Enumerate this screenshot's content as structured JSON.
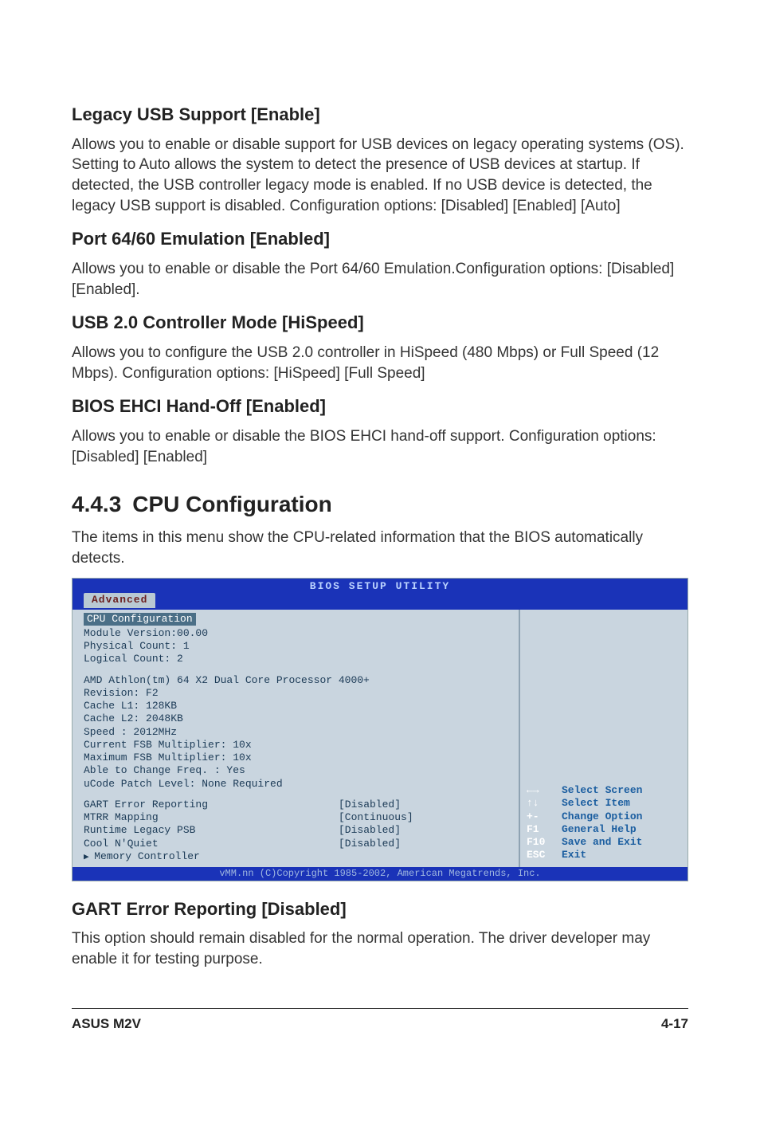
{
  "sections": {
    "legacy_usb": {
      "heading": "Legacy USB Support [Enable]",
      "text": "Allows you to enable or disable support for USB devices on legacy operating systems (OS). Setting to Auto allows the system to detect the presence of USB devices at startup. If detected, the USB controller legacy mode is enabled. If no USB device is detected, the legacy USB support is disabled. Configuration options: [Disabled] [Enabled] [Auto]"
    },
    "port6460": {
      "heading": "Port 64/60 Emulation [Enabled]",
      "text": "Allows you to enable or disable the Port 64/60 Emulation.Configuration options: [Disabled] [Enabled]."
    },
    "usb20": {
      "heading": "USB 2.0 Controller Mode [HiSpeed]",
      "text": "Allows you to configure the USB 2.0 controller in HiSpeed (480 Mbps) or Full Speed (12 Mbps). Configuration options: [HiSpeed] [Full Speed]"
    },
    "ehci": {
      "heading": "BIOS EHCI Hand-Off [Enabled]",
      "text": "Allows you to enable or disable the BIOS EHCI hand-off support. Configuration options: [Disabled] [Enabled]"
    }
  },
  "cpu_section": {
    "num": "4.4.3",
    "title": "CPU Configuration",
    "intro": "The items in this menu show the CPU-related information that the BIOS automatically detects."
  },
  "bios": {
    "header": "BIOS SETUP UTILITY",
    "tab": "Advanced",
    "panel_title": "CPU Configuration",
    "info_lines": [
      "Module Version:00.00",
      "Physical Count: 1",
      "Logical Count: 2"
    ],
    "cpu_lines": [
      "AMD Athlon(tm) 64 X2 Dual Core Processor 4000+",
      "Revision: F2",
      "Cache L1: 128KB",
      "Cache L2: 2048KB",
      "Speed   : 2012MHz",
      "Current FSB Multiplier: 10x",
      "Maximum FSB Multiplier: 10x",
      "Able to Change Freq. : Yes",
      "uCode Patch Level: None Required"
    ],
    "settings": [
      {
        "label": "GART Error Reporting",
        "value": "[Disabled]"
      },
      {
        "label": "MTRR Mapping",
        "value": "[Continuous]"
      },
      {
        "label": "Runtime Legacy PSB",
        "value": "[Disabled]"
      },
      {
        "label": "Cool N'Quiet",
        "value": "[Disabled]"
      }
    ],
    "submenu": "Memory Controller",
    "help": [
      {
        "key": "←→",
        "label": "Select Screen"
      },
      {
        "key": "↑↓",
        "label": "Select Item"
      },
      {
        "key": "+-",
        "label": "Change Option"
      },
      {
        "key": "F1",
        "label": "General Help"
      },
      {
        "key": "F10",
        "label": "Save and Exit"
      },
      {
        "key": "ESC",
        "label": "Exit"
      }
    ],
    "footer": "vMM.nn (C)Copyright 1985-2002, American Megatrends, Inc."
  },
  "gart": {
    "heading": "GART Error Reporting [Disabled]",
    "text": "This option should remain disabled for the normal operation. The driver developer may enable it for testing purpose."
  },
  "page_footer": {
    "left": "ASUS M2V",
    "right": "4-17"
  }
}
